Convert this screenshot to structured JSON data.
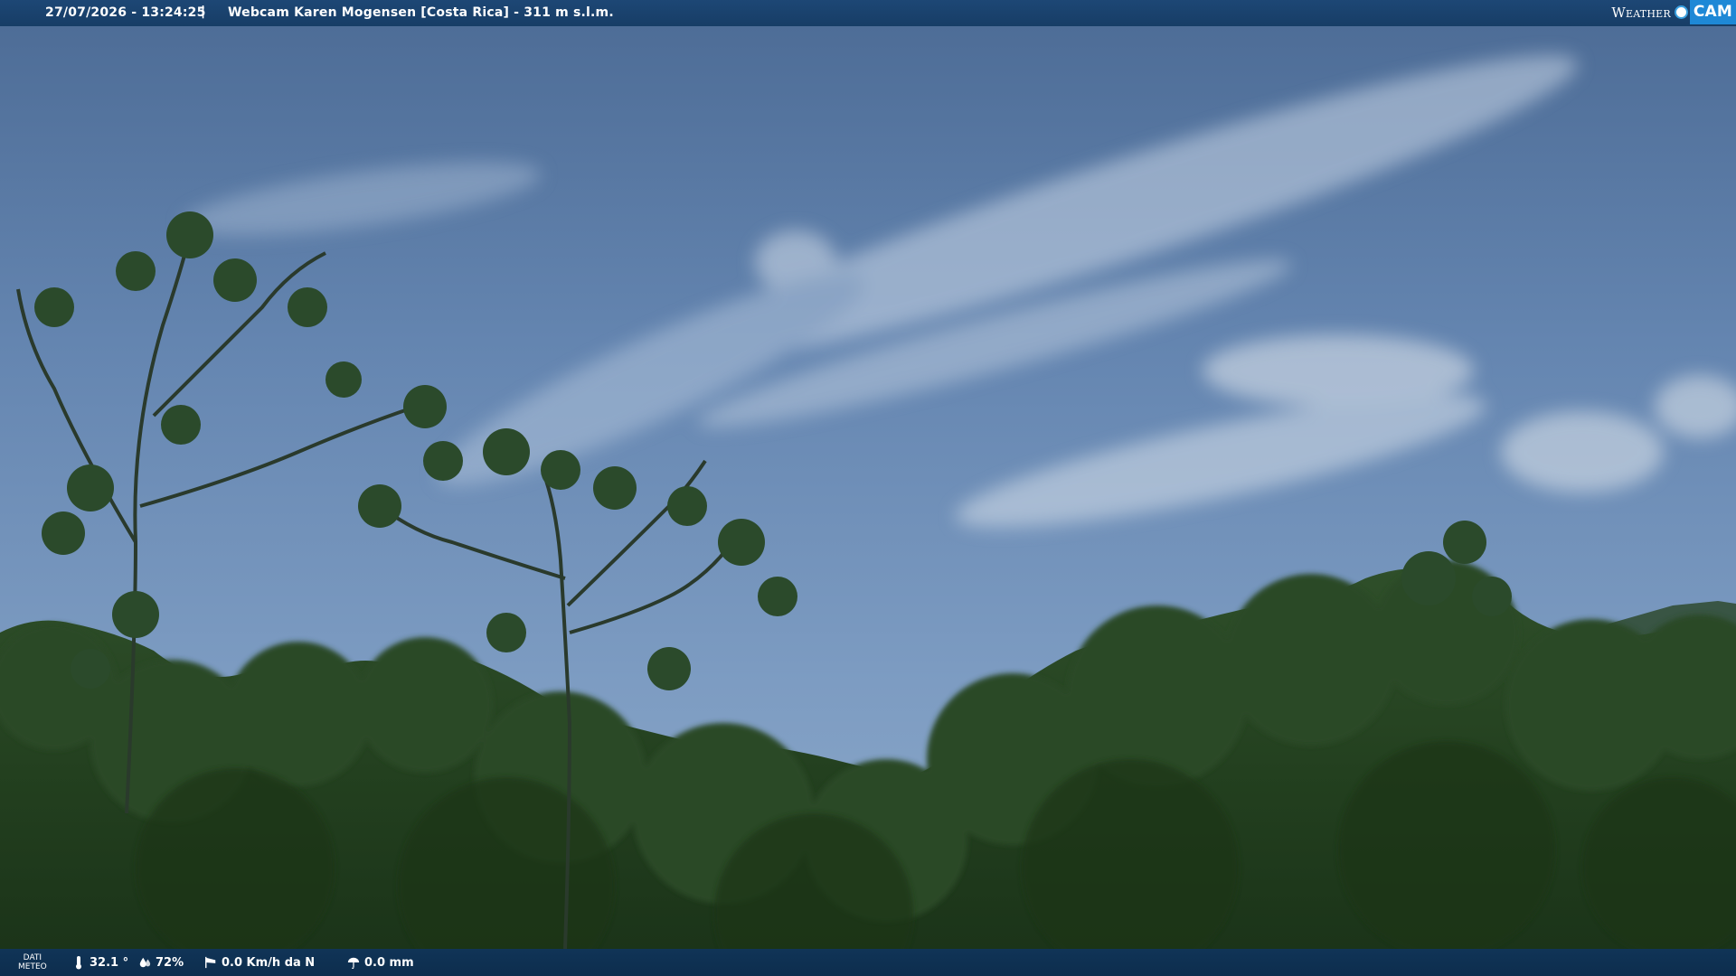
{
  "header": {
    "timestamp": "27/07/2026 - 13:24:25",
    "separator": "|",
    "title": "Webcam Karen Mogensen [Costa Rica]  - 311 m s.l.m."
  },
  "logo": {
    "word": "Weather",
    "cam": "CAM"
  },
  "weather": {
    "label_line1": "DATI",
    "label_line2": "METEO",
    "temperature": "32.1 °",
    "humidity": "72%",
    "wind": "0.0 Km/h da N",
    "rain": "0.0 mm"
  },
  "colors": {
    "header_bg": "#1d4775",
    "footer_bg": "#103457",
    "logo_accent": "#1e88d6",
    "sky": "#5b7aa3",
    "forest": "#223c1f"
  }
}
